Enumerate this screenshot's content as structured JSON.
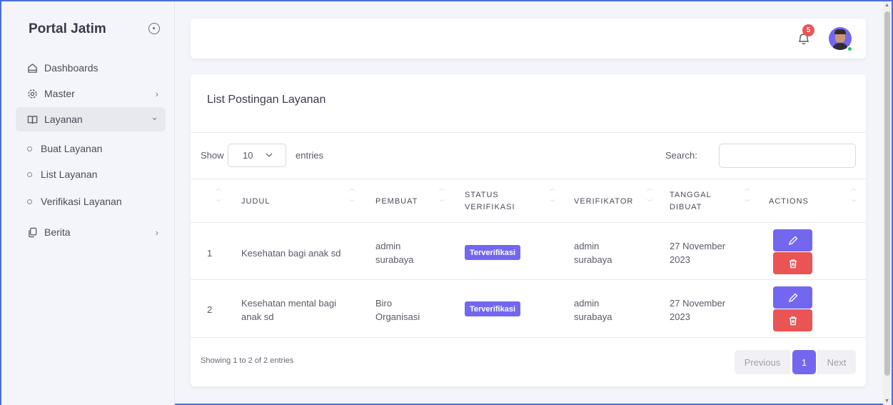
{
  "sidebar": {
    "brand": "Portal Jatim",
    "items": [
      {
        "label": "Dashboards",
        "icon": "home-icon"
      },
      {
        "label": "Master",
        "icon": "settings-icon",
        "chevron": "›"
      },
      {
        "label": "Layanan",
        "icon": "book-icon",
        "chevron": "⌄"
      },
      {
        "label": "Berita",
        "icon": "copy-icon",
        "chevron": "›"
      }
    ],
    "sub_items": [
      "Buat Layanan",
      "List Layanan",
      "Verifikasi Layanan"
    ]
  },
  "topbar": {
    "notification_count": "5"
  },
  "card": {
    "title": "List Postingan Layanan",
    "show_label": "Show",
    "length_value": "10",
    "entries_label": "entries",
    "search_label": "Search:",
    "search_value": "",
    "columns": [
      "JUDUL",
      "PEMBUAT",
      "STATUS VERIFIKASI",
      "VERIFIKATOR",
      "TANGGAL DIBUAT",
      "ACTIONS"
    ],
    "rows": [
      {
        "no": "1",
        "judul": "Kesehatan bagi anak sd",
        "pembuat": "admin surabaya",
        "status": "Terverifikasi",
        "verifikator": "admin surabaya",
        "tanggal": "27 November 2023"
      },
      {
        "no": "2",
        "judul": "Kesehatan mental bagi anak sd",
        "pembuat": "Biro Organisasi",
        "status": "Terverifikasi",
        "verifikator": "admin surabaya",
        "tanggal": "27 November 2023"
      }
    ],
    "info": "Showing 1 to 2 of 2 entries",
    "pagination": {
      "previous": "Previous",
      "current": "1",
      "next": "Next"
    }
  },
  "colors": {
    "primary": "#7367f0",
    "danger": "#ea5455",
    "online": "#28c76f"
  }
}
